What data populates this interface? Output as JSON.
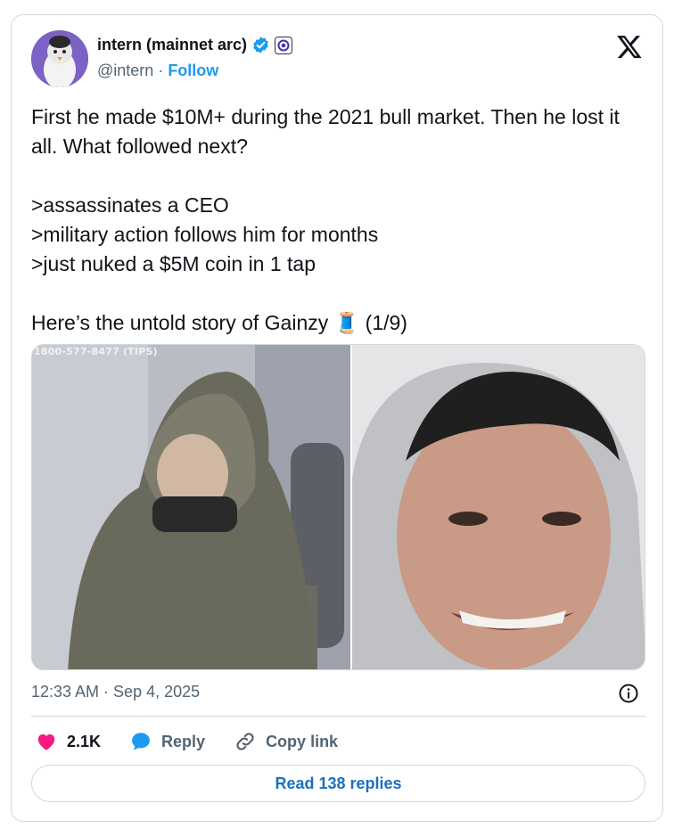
{
  "author": {
    "display_name": "intern (mainnet arc)",
    "handle": "@intern",
    "separator": "·",
    "follow_label": "Follow"
  },
  "tweet": {
    "text": "First he made $10M+ during the 2021 bull market. Then he lost it all. What followed next?\n\n>assassinates a CEO\n>military action follows him for months\n>just nuked a $5M coin in 1 tap\n\nHere’s the untold story of Gainzy 🧵 (1/9)"
  },
  "media": {
    "left_caption": "1800-577-8477 (TIPS)"
  },
  "meta": {
    "timestamp": "12:33 AM · Sep 4, 2025"
  },
  "actions": {
    "likes": "2.1K",
    "reply_label": "Reply",
    "copy_link_label": "Copy link"
  },
  "read_replies_label": "Read 138 replies",
  "colors": {
    "accent": "#1d9bf0",
    "like": "#f91880",
    "text": "#0f1419",
    "muted": "#536471",
    "border": "#cfd9de"
  },
  "icons": [
    "verified-badge-icon",
    "affiliate-badge-icon",
    "x-logo-icon",
    "info-icon",
    "heart-icon",
    "reply-bubble-icon",
    "link-icon",
    "thread-spool-emoji"
  ]
}
